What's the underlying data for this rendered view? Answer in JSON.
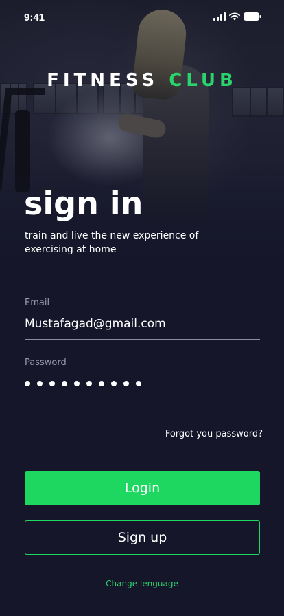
{
  "status_bar": {
    "time": "9:41",
    "icons": [
      "signal-icon",
      "wifi-icon",
      "battery-icon"
    ]
  },
  "brand": {
    "part1": "FITNESS",
    "part2": "CLUB"
  },
  "header": {
    "title": "sign in",
    "subtitle": "train and live the new experience of exercising at home"
  },
  "form": {
    "email_label": "Email",
    "email_value": "Mustafagad@gmail.com",
    "password_label": "Password",
    "password_mask_count": 10,
    "forgot_link": "Forgot you password?"
  },
  "buttons": {
    "login": "Login",
    "signup": "Sign up"
  },
  "footer": {
    "change_language": "Change lenguage"
  },
  "colors": {
    "accent": "#1ed760",
    "background": "#15162a",
    "text": "#ffffff",
    "label": "#9a9bab"
  }
}
